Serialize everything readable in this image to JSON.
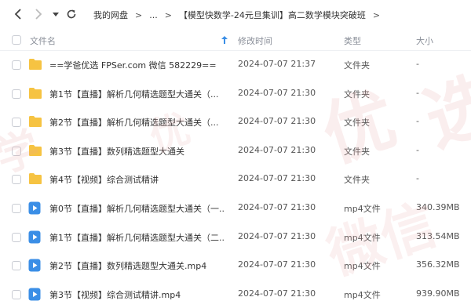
{
  "toolbar": {
    "breadcrumbs": [
      "我的网盘",
      "...",
      "【模型快数学-24元旦集训】高二数学模块突破班"
    ]
  },
  "columns": {
    "name": "文件名",
    "modified": "修改时间",
    "type": "类型",
    "size": "大小"
  },
  "files": [
    {
      "name": "==学爸优选 FPSer.com 微信 582229==",
      "time": "2024-07-07 21:37",
      "type": "文件夹",
      "size": "-",
      "icon": "folder-icon"
    },
    {
      "name": "第1节【直播】解析几何精选题型大通关（...",
      "time": "2024-07-07 21:30",
      "type": "文件夹",
      "size": "-",
      "icon": "folder-icon"
    },
    {
      "name": "第2节【直播】解析几何精选题型大通关（...",
      "time": "2024-07-07 21:30",
      "type": "文件夹",
      "size": "-",
      "icon": "folder-icon"
    },
    {
      "name": "第3节【直播】数列精选题型大通关",
      "time": "2024-07-07 21:30",
      "type": "文件夹",
      "size": "-",
      "icon": "folder-icon"
    },
    {
      "name": "第4节【视频】综合测试精讲",
      "time": "2024-07-07 21:30",
      "type": "文件夹",
      "size": "-",
      "icon": "folder-icon"
    },
    {
      "name": "第0节【直播】解析几何精选题型大通关（一...",
      "time": "2024-07-07 21:30",
      "type": "mp4文件",
      "size": "340.39MB",
      "icon": "video-icon"
    },
    {
      "name": "第1节【直播】解析几何精选题型大通关（二...",
      "time": "2024-07-07 21:30",
      "type": "mp4文件",
      "size": "313.54MB",
      "icon": "video-icon"
    },
    {
      "name": "第2节【直播】数列精选题型大通关.mp4",
      "time": "2024-07-07 21:30",
      "type": "mp4文件",
      "size": "356.32MB",
      "icon": "video-icon"
    },
    {
      "name": "第3节【视频】综合测试精讲.mp4",
      "time": "2024-07-07 21:30",
      "type": "mp4文件",
      "size": "939.90MB",
      "icon": "video-icon"
    }
  ],
  "colors": {
    "folder": "#f6c342",
    "video": "#3a8ee6",
    "watermark": "#e8a0a0"
  }
}
